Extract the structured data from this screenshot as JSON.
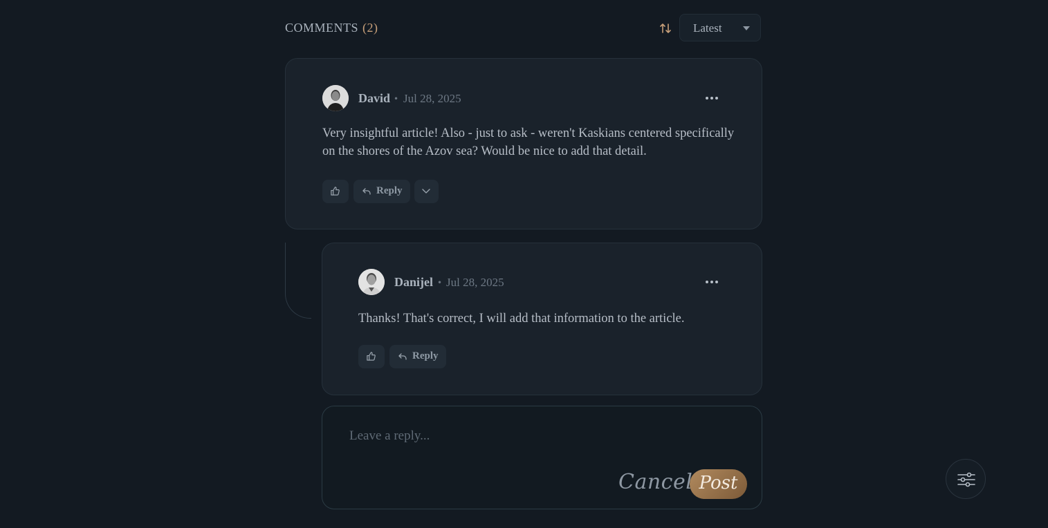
{
  "header": {
    "title": "COMMENTS",
    "count": "(2)",
    "sort_value": "Latest"
  },
  "comments": [
    {
      "author": "David",
      "date": "Jul 28, 2025",
      "body_line1": "Very insightful article! Also - just to ask - weren't Kaskians centered specifically",
      "body_line2": "on the shores of the Azov sea? Would be nice to add that detail.",
      "reply_label": "Reply"
    },
    {
      "author": "Danijel",
      "date": "Jul 28, 2025",
      "body": "Thanks! That's correct, I will add that information to the article.",
      "reply_label": "Reply"
    }
  ],
  "reply_form": {
    "placeholder": "Leave a reply...",
    "cancel_label": "Cancel",
    "post_label": "Post"
  },
  "colors": {
    "background": "#131a22",
    "card": "#1a222b",
    "accent": "#c8a07a"
  }
}
